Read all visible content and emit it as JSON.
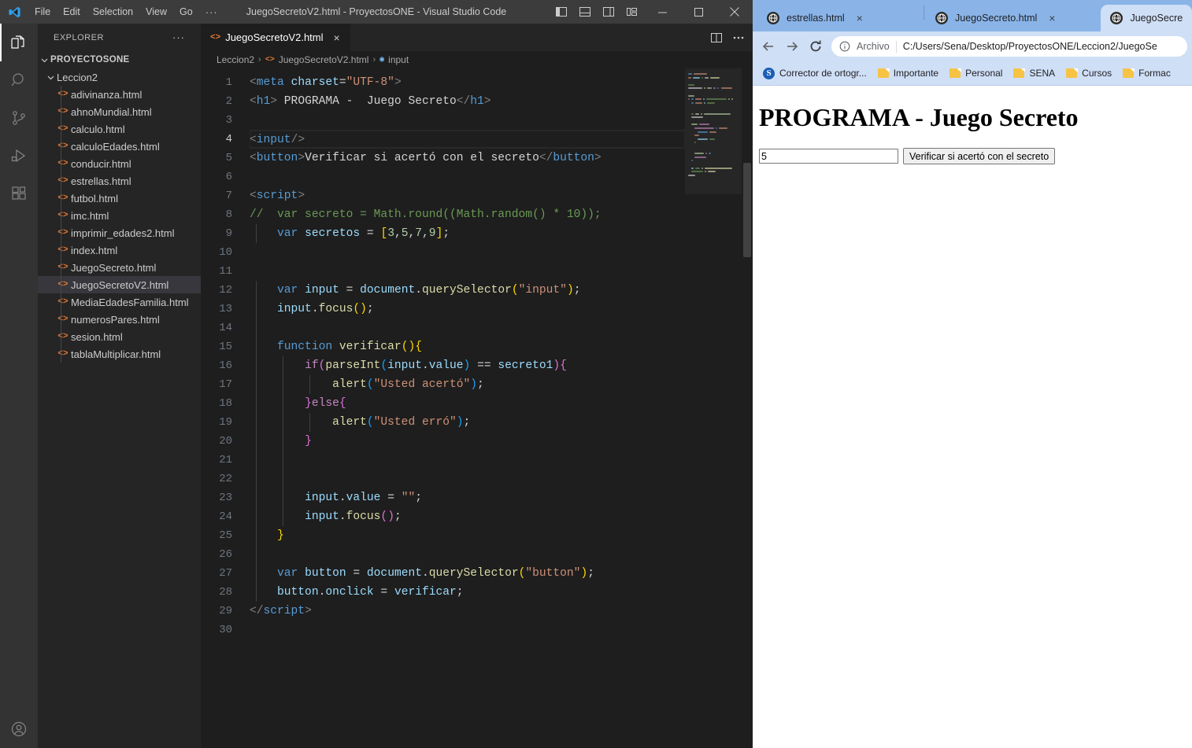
{
  "vscode": {
    "window_title": "JuegoSecretoV2.html - ProyectosONE - Visual Studio Code",
    "menu": [
      "File",
      "Edit",
      "Selection",
      "View",
      "Go"
    ],
    "menu_more": "···",
    "sidebar": {
      "header": "EXPLORER",
      "header_more": "···",
      "root": "PROYECTOSONE",
      "folder": "Leccion2",
      "files": [
        "adivinanza.html",
        "ahnoMundial.html",
        "calculo.html",
        "calculoEdades.html",
        "conducir.html",
        "estrellas.html",
        "futbol.html",
        "imc.html",
        "imprimir_edades2.html",
        "index.html",
        "JuegoSecreto.html",
        "JuegoSecretoV2.html",
        "MediaEdadesFamilia.html",
        "numerosPares.html",
        "sesion.html",
        "tablaMultiplicar.html"
      ],
      "selected_file": "JuegoSecretoV2.html"
    },
    "tab": {
      "label": "JuegoSecretoV2.html",
      "close": "×"
    },
    "breadcrumbs": [
      "Leccion2",
      "JuegoSecretoV2.html",
      "input"
    ],
    "editor": {
      "current_line": 4,
      "total_lines": 30,
      "line_numbers": [
        1,
        2,
        3,
        4,
        5,
        6,
        7,
        8,
        9,
        10,
        11,
        12,
        13,
        14,
        15,
        16,
        17,
        18,
        19,
        20,
        21,
        22,
        23,
        24,
        25,
        26,
        27,
        28,
        29,
        30
      ],
      "lines_plain": [
        "<meta charset=\"UTF-8\">",
        "<h1> PROGRAMA -  Juego Secreto</h1>",
        "",
        "<input/>",
        "<button>Verificar si acertó con el secreto</button>",
        "",
        "<script>",
        "//  var secreto = Math.round((Math.random() * 10));",
        "    var secretos = [3,5,7,9];",
        "",
        "",
        "    var input = document.querySelector(\"input\");",
        "    input.focus();",
        "",
        "    function verificar(){",
        "        if(parseInt(input.value) == secreto1){",
        "            alert(\"Usted acertó\");",
        "        }else{",
        "            alert(\"Usted erró\");",
        "        }",
        "",
        "",
        "        input.value = \"\";",
        "        input.focus();",
        "    }",
        "",
        "    var button = document.querySelector(\"button\");",
        "    button.onclick = verificar;",
        "</script>",
        ""
      ]
    },
    "icons": {
      "explorer": "files-icon",
      "search": "search-icon",
      "source_control": "source-control-icon",
      "run_debug": "run-and-debug-icon",
      "extensions": "extensions-icon",
      "account": "account-icon"
    },
    "window_controls": {
      "toggle_primary_sidebar": "layout-sidebar-icon",
      "toggle_panel": "layout-panel-icon",
      "toggle_secondary_sidebar": "layout-secondary-icon",
      "customize_layout": "layout-customize-icon",
      "minimize": "—",
      "maximize": "□",
      "close": "×"
    }
  },
  "browser": {
    "tabs": [
      {
        "title": "estrellas.html",
        "active": false,
        "close": "×"
      },
      {
        "title": "JuegoSecreto.html",
        "active": false,
        "close": "×"
      },
      {
        "title": "JuegoSecre",
        "active": true,
        "close": ""
      }
    ],
    "toolbar": {
      "back": "back-arrow-icon",
      "forward": "forward-arrow-icon",
      "reload": "reload-icon"
    },
    "omnibox": {
      "info_icon": "info-circle-icon",
      "scheme_label": "Archivo",
      "url": "C:/Users/Sena/Desktop/ProyectosONE/Leccion2/JuegoSe"
    },
    "bookmarks": [
      {
        "label": "Corrector de ortogr...",
        "icon": "grammarly-icon"
      },
      {
        "label": "Importante",
        "icon": "folder-icon"
      },
      {
        "label": "Personal",
        "icon": "folder-icon"
      },
      {
        "label": "SENA",
        "icon": "folder-icon"
      },
      {
        "label": "Cursos",
        "icon": "folder-icon"
      },
      {
        "label": "Formac",
        "icon": "folder-icon"
      }
    ],
    "page": {
      "heading": "PROGRAMA - Juego Secreto",
      "input_value": "5",
      "input_placeholder": "",
      "button_label": "Verificar si acertó con el secreto"
    }
  },
  "colors": {
    "vscode_bg": "#1e1e1e",
    "vscode_sidebar": "#252526",
    "vscode_titlebar": "#3c3c3c",
    "vscode_activitybar": "#333333",
    "accent_orange": "#e37933",
    "chrome_tabstrip": "#8ab4e8",
    "chrome_toolbar": "#cfdff6"
  }
}
